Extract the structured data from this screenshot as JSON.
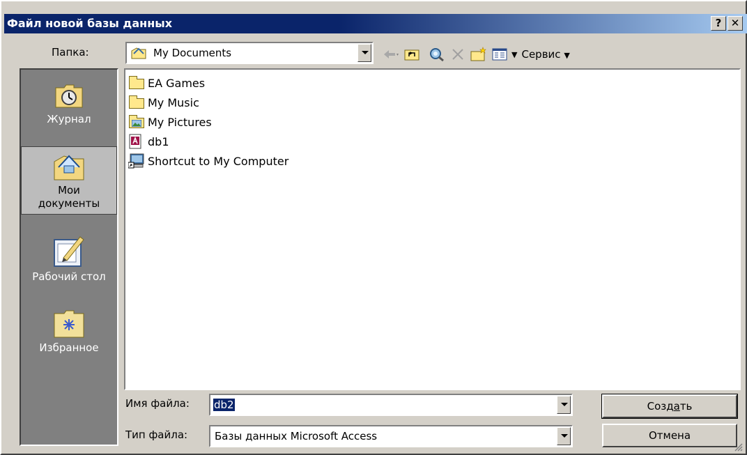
{
  "window": {
    "title": "Файл новой базы данных",
    "help_glyph": "?",
    "close_glyph": "✕"
  },
  "location": {
    "label": "Папка:",
    "value": "My Documents"
  },
  "toolbar": {
    "tools_label": "Сервис"
  },
  "places": [
    {
      "label": "Журнал",
      "icon": "history-icon"
    },
    {
      "label": "Мои документы",
      "icon": "my-documents-icon"
    },
    {
      "label": "Рабочий стол",
      "icon": "desktop-icon"
    },
    {
      "label": "Избранное",
      "icon": "favorites-icon"
    }
  ],
  "files": [
    {
      "name": "EA Games",
      "icon": "folder-icon"
    },
    {
      "name": "My Music",
      "icon": "folder-icon"
    },
    {
      "name": "My Pictures",
      "icon": "pictures-folder-icon"
    },
    {
      "name": "db1",
      "icon": "access-database-icon"
    },
    {
      "name": "Shortcut to My Computer",
      "icon": "computer-shortcut-icon"
    }
  ],
  "form": {
    "filename_label": "Имя файла:",
    "filename_value": "db2",
    "filetype_label": "Тип файла:",
    "filetype_value": "Базы данных Microsoft Access"
  },
  "buttons": {
    "create_prefix": "Созд",
    "create_accel": "а",
    "create_suffix": "ть",
    "cancel": "Отмена"
  },
  "colors": {
    "titlebar_start": "#0a246a",
    "titlebar_end": "#a6caf0",
    "dialog_face": "#d4d0c8",
    "places_bar": "#808080",
    "selection": "#0a246a"
  }
}
